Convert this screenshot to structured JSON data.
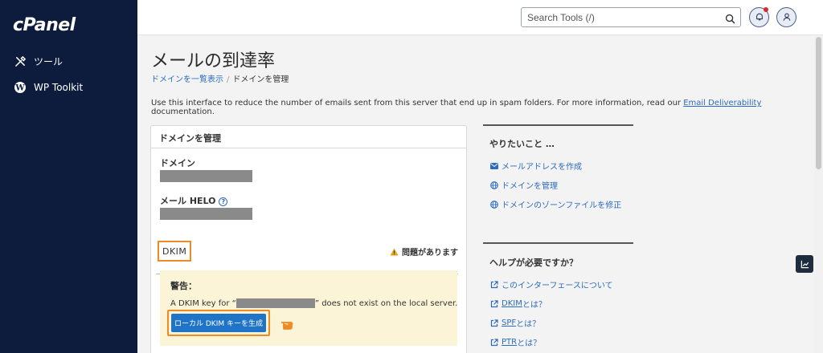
{
  "brand": {
    "logo_text": "cPanel"
  },
  "sidebar": {
    "items": [
      {
        "label": "ツール",
        "icon": "tools-icon"
      },
      {
        "label": "WP Toolkit",
        "icon": "wordpress-icon"
      }
    ]
  },
  "header": {
    "search_placeholder": "Search Tools (/)",
    "notification_icon": "bell-icon",
    "user_icon": "user-icon"
  },
  "page": {
    "title": "メールの到達率",
    "breadcrumb": [
      "ドメインを一覧表示",
      "ドメインを管理"
    ],
    "description_prefix": "Use this interface to reduce the number of emails sent from this server that end up in spam folders. For more information, read our ",
    "description_link": "Email Deliverability",
    "description_suffix": " documentation."
  },
  "panel": {
    "title": "ドメインを管理",
    "domain_label": "ドメイン",
    "helo_label": "メール HELO",
    "dkim_tab": "DKIM",
    "issue_text": "問題があります",
    "warning_title": "警告：",
    "warning_text_prefix": "A DKIM key for “",
    "warning_text_suffix": "” does not exist on the local server.",
    "generate_button": "ローカル DKIM キーを生成"
  },
  "right": {
    "todo_title": "やりたいこと …",
    "todo_links": [
      {
        "label": "メールアドレスを作成",
        "icon": "envelope-icon"
      },
      {
        "label": "ドメインを管理",
        "icon": "globe-icon"
      },
      {
        "label": "ドメインのゾーンファイルを修正",
        "icon": "globe-icon"
      }
    ],
    "help_title": "ヘルプが必要ですか？",
    "help_links": [
      {
        "label": "このインターフェースについて",
        "icon": "external-link-icon"
      },
      {
        "label_u": "DKIM",
        "label": "とは？",
        "icon": "external-link-icon"
      },
      {
        "label_u": "SPF",
        "label": "とは？",
        "icon": "external-link-icon"
      },
      {
        "label_u": "PTR",
        "label": "とは？",
        "icon": "external-link-icon"
      }
    ]
  },
  "colors": {
    "sidebar_bg": "#0d1b3d",
    "link": "#2b6bbf",
    "button": "#1f74c8",
    "highlight": "#f08a24",
    "warning_bg": "#fbf4d6"
  }
}
